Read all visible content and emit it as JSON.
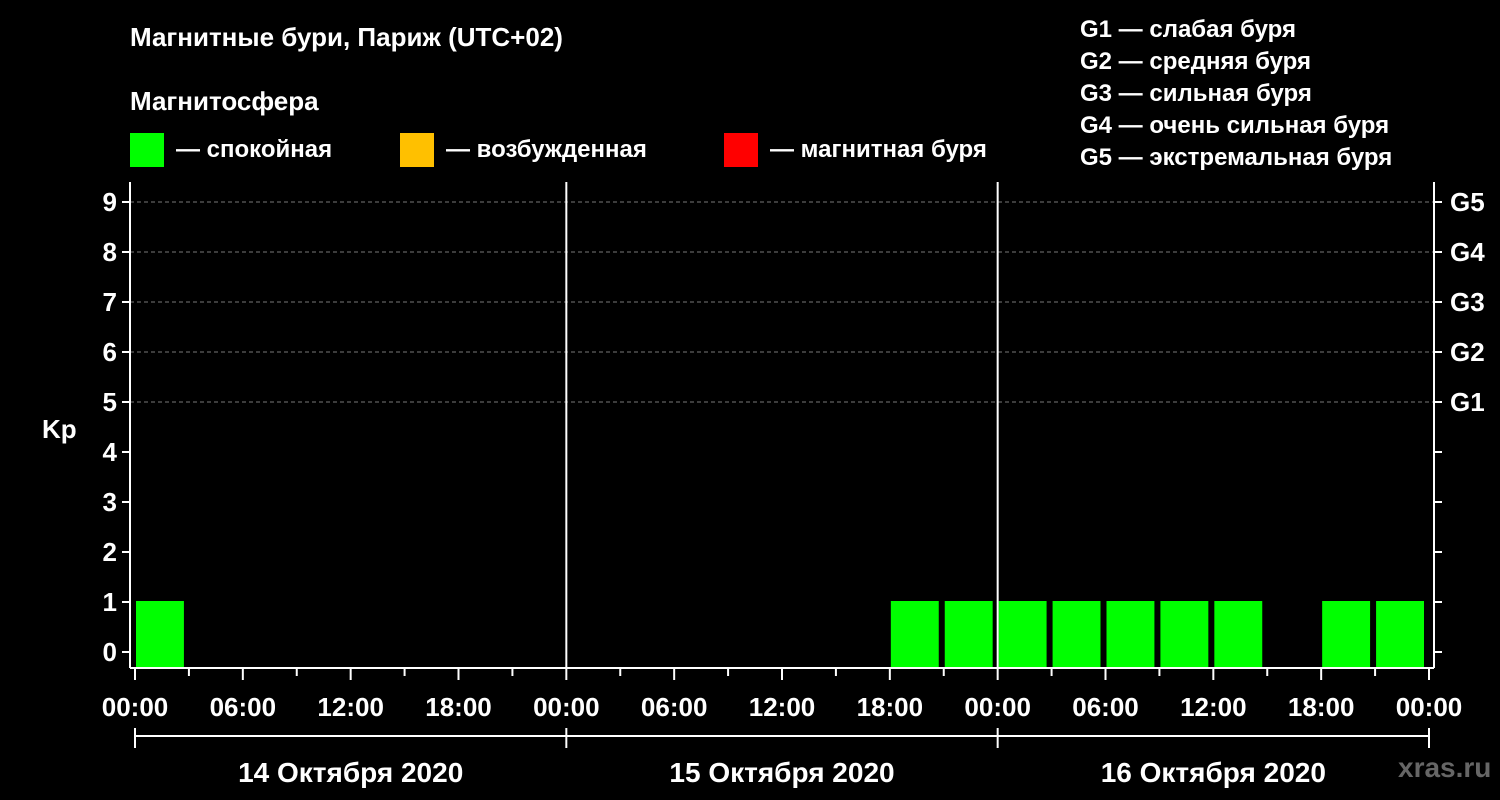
{
  "header": {
    "title": "Магнитные бури, Париж (UTC+02)",
    "subtitle": "Магнитосфера"
  },
  "legend": {
    "items": [
      {
        "color": "#00ff00",
        "label": "— спокойная"
      },
      {
        "color": "#ffc000",
        "label": "— возбужденная"
      },
      {
        "color": "#ff0000",
        "label": "— магнитная буря"
      }
    ]
  },
  "storm_levels": [
    "G1 — слабая буря",
    "G2 — средняя буря",
    "G3 — сильная буря",
    "G4 — очень сильная буря",
    "G5 — экстремальная буря"
  ],
  "watermark": "xras.ru",
  "chart_data": {
    "type": "bar",
    "ylabel": "Kp",
    "ylim": [
      0,
      9
    ],
    "yticks": [
      "0",
      "1",
      "2",
      "3",
      "4",
      "5",
      "6",
      "7",
      "8",
      "9"
    ],
    "right_labels": [
      {
        "kp": 5,
        "label": "G1"
      },
      {
        "kp": 6,
        "label": "G2"
      },
      {
        "kp": 7,
        "label": "G3"
      },
      {
        "kp": 8,
        "label": "G4"
      },
      {
        "kp": 9,
        "label": "G5"
      }
    ],
    "grid": "dashed horizontal at Kp 6-9",
    "xtick_labels": [
      "00:00",
      "06:00",
      "12:00",
      "18:00",
      "00:00",
      "06:00",
      "12:00",
      "18:00",
      "00:00",
      "06:00",
      "12:00",
      "18:00",
      "00:00"
    ],
    "days": [
      "14 Октября 2020",
      "15 Октября 2020",
      "16 Октября 2020"
    ],
    "interval_hours": 3,
    "kp": [
      1,
      0,
      0,
      0,
      0,
      0,
      0,
      0,
      0,
      0,
      0,
      0,
      0,
      0,
      1,
      1,
      1,
      1,
      1,
      1,
      1,
      0,
      1,
      1
    ],
    "colors": {
      "quiet": "#00ff00",
      "active": "#ffc000",
      "storm": "#ff0000"
    }
  }
}
